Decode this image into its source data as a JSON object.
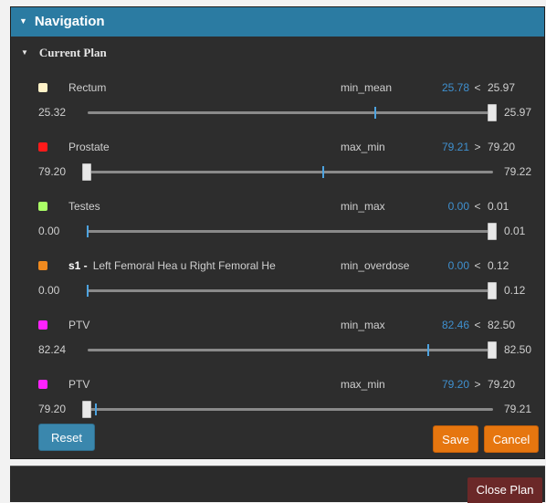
{
  "navigation": {
    "title": "Navigation"
  },
  "current_plan": {
    "title": "Current Plan"
  },
  "constraints": [
    {
      "color": "#fff2c8",
      "name_prefix": "",
      "name": "Rectum",
      "type": "min_mean",
      "value": "25.78",
      "op": "<",
      "target": "25.97",
      "min": "25.32",
      "max": "25.97",
      "marker_fraction": 0.71,
      "handle_fraction": 1.0
    },
    {
      "color": "#ff1a1a",
      "name_prefix": "",
      "name": "Prostate",
      "type": "max_min",
      "value": "79.21",
      "op": ">",
      "target": "79.20",
      "min": "79.20",
      "max": "79.22",
      "marker_fraction": 0.58,
      "handle_fraction": 0.0
    },
    {
      "color": "#aaff66",
      "name_prefix": "",
      "name": "Testes",
      "type": "min_max",
      "value": "0.00",
      "op": "<",
      "target": "0.01",
      "min": "0.00",
      "max": "0.01",
      "marker_fraction": 0.0,
      "handle_fraction": 1.0
    },
    {
      "color": "#f08a1f",
      "name_prefix": "s1 -",
      "name": "Left Femoral Hea   u   Right Femoral He",
      "type": "min_overdose",
      "value": "0.00",
      "op": "<",
      "target": "0.12",
      "min": "0.00",
      "max": "0.12",
      "marker_fraction": 0.0,
      "handle_fraction": 1.0
    },
    {
      "color": "#ff22ff",
      "name_prefix": "",
      "name": "PTV",
      "type": "min_max",
      "value": "82.46",
      "op": "<",
      "target": "82.50",
      "min": "82.24",
      "max": "82.50",
      "marker_fraction": 0.84,
      "handle_fraction": 1.0
    },
    {
      "color": "#ff22ff",
      "name_prefix": "",
      "name": "PTV",
      "type": "max_min",
      "value": "79.20",
      "op": ">",
      "target": "79.20",
      "min": "79.20",
      "max": "79.21",
      "marker_fraction": 0.02,
      "handle_fraction": 0.0
    }
  ],
  "buttons": {
    "reset": "Reset",
    "save": "Save",
    "cancel": "Cancel",
    "close_plan": "Close Plan"
  }
}
